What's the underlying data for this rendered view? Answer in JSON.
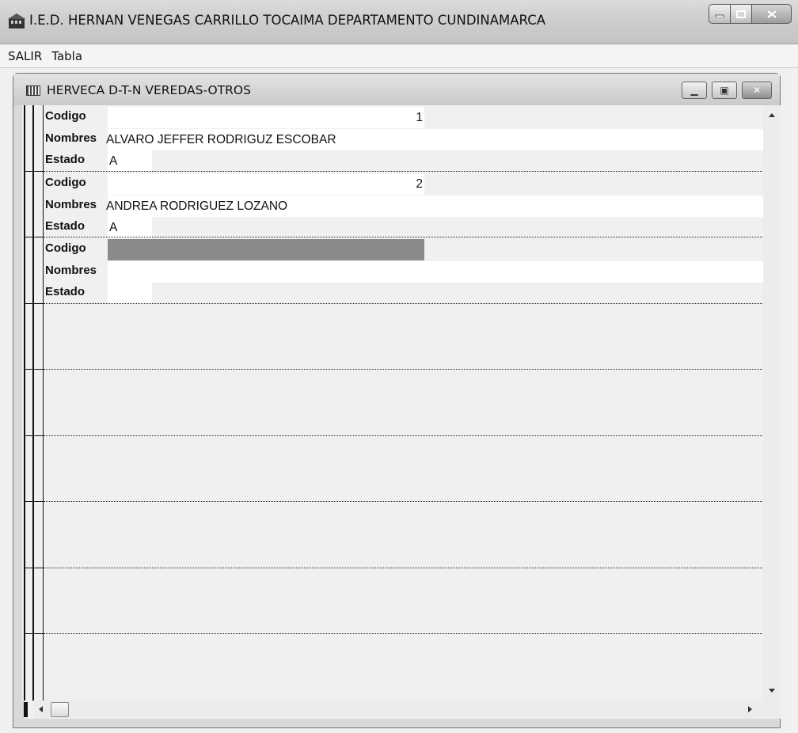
{
  "window": {
    "title": "I.E.D. HERNAN VENEGAS CARRILLO TOCAIMA DEPARTAMENTO CUNDINAMARCA",
    "icon": "app-building-icon"
  },
  "menu": {
    "items": [
      {
        "label": "SALIR"
      },
      {
        "label": "Tabla"
      }
    ]
  },
  "child": {
    "title": "HERVECA D-T-N VEREDAS-OTROS",
    "icon": "table-grid-icon"
  },
  "fields": {
    "codigo_label": "Codigo",
    "nombres_label": "Nombres",
    "estado_label": "Estado"
  },
  "records": [
    {
      "codigo": "1",
      "nombres": "ALVARO JEFFER RODRIGUZ ESCOBAR",
      "estado": "A"
    },
    {
      "codigo": "2",
      "nombres": "ANDREA RODRIGUEZ LOZANO",
      "estado": "A"
    },
    {
      "codigo": "",
      "nombres": "",
      "estado": ""
    }
  ]
}
